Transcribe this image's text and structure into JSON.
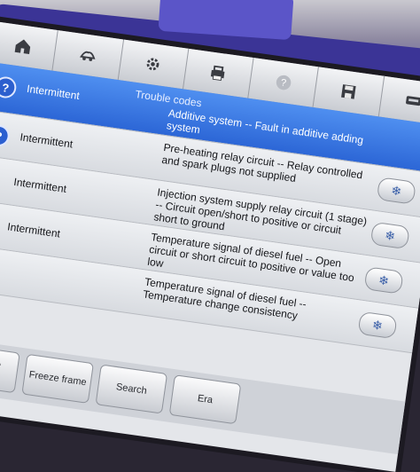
{
  "toolbar": {
    "icons": [
      "home-icon",
      "vehicle-icon",
      "settings-icon",
      "print-icon",
      "help-icon",
      "save-icon",
      "recorder-icon"
    ]
  },
  "screen": {
    "title": "Trouble codes"
  },
  "codes": [
    {
      "status": "Intermittent",
      "description": "Additive system -- Fault in additive adding system",
      "selected": true
    },
    {
      "status": "Intermittent",
      "description": "Pre-heating relay circuit -- Relay controlled and spark plugs not supplied",
      "selected": false
    },
    {
      "status": "Intermittent",
      "description": "Injection system supply relay circuit (1 stage) -- Circuit open/short to positive or circuit short to ground",
      "selected": false
    },
    {
      "status": "Intermittent",
      "description": "Temperature signal of diesel fuel -- Open circuit or short circuit to positive or value too low",
      "selected": false
    },
    {
      "status": "Intermittent",
      "description": "Temperature signal of diesel fuel -- Temperature change consistency",
      "selected": false
    }
  ],
  "bottom_bar": {
    "service_manual": "Service manual",
    "freeze_frame": "Freeze frame",
    "search": "Search",
    "partial": "Era"
  },
  "colors": {
    "selected_row": "#2c66d6",
    "toolbar": "#e4e6ea"
  }
}
